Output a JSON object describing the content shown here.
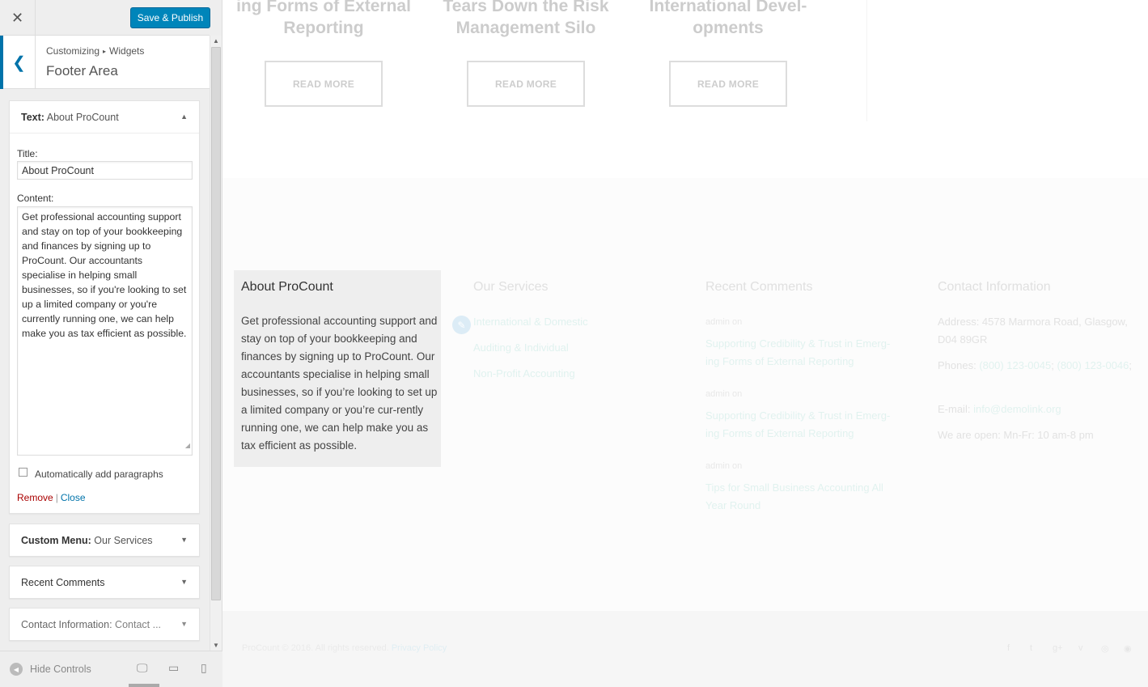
{
  "customizer": {
    "close_symbol": "✕",
    "publish_label": "Save & Publish",
    "back_symbol": "❮",
    "breadcrumb": {
      "root": "Customizing",
      "sep": "▸",
      "current": "Widgets"
    },
    "section_title": "Footer Area",
    "text_widget": {
      "type_label": "Text:",
      "name": "About ProCount",
      "title_label": "Title:",
      "title_value": "About ProCount",
      "content_label": "Content:",
      "content_value": "Get professional accounting support and stay on top of your bookkeeping and finances by signing up to ProCount. Our accountants specialise in helping small businesses, so if you're looking to set up a limited company or you're currently running one, we can help make you as tax efficient as possible.",
      "autop_label": "Automatically add paragraphs",
      "autop_checked": false,
      "remove_label": "Remove",
      "separator": "|",
      "close_label": "Close"
    },
    "collapsed_widgets": {
      "menu": {
        "type_label": "Custom Menu:",
        "name": "Our Services"
      },
      "comments": {
        "type_label": "Recent Comments",
        "name": ""
      },
      "contact": {
        "type_label": "Contact Information:",
        "name": "Contact ..."
      }
    },
    "controls": {
      "hide_label": "Hide Controls"
    },
    "icons": [
      "close-icon",
      "chevron-left-icon",
      "caret-up-icon",
      "caret-down-icon",
      "collapse-icon",
      "desktop-icon",
      "tablet-icon",
      "mobile-icon",
      "pencil-icon"
    ]
  },
  "preview": {
    "posts": [
      {
        "title_line1": "ing Forms of External",
        "title_line2": "Reporting",
        "button": "READ MORE"
      },
      {
        "title_line1": "Tears Down the Risk",
        "title_line2": "Management Silo",
        "button": "READ MORE"
      },
      {
        "title_line1": "International Devel-",
        "title_line2": "opments",
        "button": "READ MORE"
      }
    ],
    "about": {
      "title": "About ProCount",
      "text": "Get professional accounting support and stay on top of your bookkeeping and finances by signing up to ProCount. Our accountants specialise in helping small businesses, so if you’re looking to set up a limited company or you’re cur-rently running one, we can help make you as tax efficient as possible."
    },
    "services": {
      "title": "Our Services",
      "links": [
        "International & Domestic",
        "Auditing & Individual",
        "Non-Profit Accounting"
      ]
    },
    "recent_comments": {
      "title": "Recent Comments",
      "items": [
        {
          "meta": "admin  on",
          "link": "Supporting Credibility & Trust in Emerg-ing Forms of External Reporting"
        },
        {
          "meta": "admin  on",
          "link": "Supporting Credibility & Trust in Emerg-ing Forms of External Reporting"
        },
        {
          "meta": "admin  on",
          "link": "Tips for Small Business Accounting All Year Round"
        }
      ]
    },
    "contact": {
      "title": "Contact Information",
      "address": "Address: 4578 Marmora Road, Glasgow, D04 89GR",
      "phones_label": "Phones:",
      "phone1": "(800) 123-0045",
      "phone_sep": ";",
      "phone2": "(800) 123-0046",
      "phone_end": ";",
      "email_label": "E-mail:",
      "email": "info@demolink.org",
      "hours": "We are open: Mn-Fr: 10 am-8 pm"
    },
    "footer": {
      "copyright": "ProCount © 2016. All rights reserved.",
      "privacy": "Privacy Policy"
    }
  }
}
